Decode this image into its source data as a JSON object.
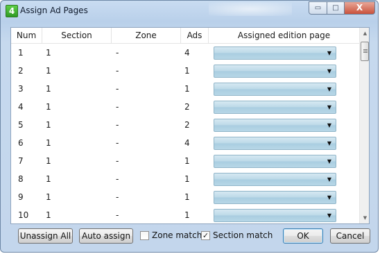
{
  "window": {
    "title": "Assign Ad Pages",
    "icon_glyph": "4"
  },
  "titlebar_buttons": {
    "minimize": "▭",
    "maximize": "□",
    "close": "X"
  },
  "columns": [
    "Num",
    "Section",
    "Zone",
    "Ads",
    "Assigned edition page"
  ],
  "rows": [
    {
      "num": "1",
      "section": "1",
      "zone": "-",
      "ads": "4"
    },
    {
      "num": "2",
      "section": "1",
      "zone": "-",
      "ads": "1"
    },
    {
      "num": "3",
      "section": "1",
      "zone": "-",
      "ads": "1"
    },
    {
      "num": "4",
      "section": "1",
      "zone": "-",
      "ads": "2"
    },
    {
      "num": "5",
      "section": "1",
      "zone": "-",
      "ads": "2"
    },
    {
      "num": "6",
      "section": "1",
      "zone": "-",
      "ads": "4"
    },
    {
      "num": "7",
      "section": "1",
      "zone": "-",
      "ads": "1"
    },
    {
      "num": "8",
      "section": "1",
      "zone": "-",
      "ads": "1"
    },
    {
      "num": "9",
      "section": "1",
      "zone": "-",
      "ads": "1"
    },
    {
      "num": "10",
      "section": "1",
      "zone": "-",
      "ads": "1"
    }
  ],
  "dropdown_arrow": "▼",
  "scrollbar": {
    "up": "▲",
    "down": "▼"
  },
  "footer": {
    "unassign_all": "Unassign All",
    "auto_assign": "Auto assign",
    "zone_match": {
      "label": "Zone match",
      "checked": false
    },
    "section_match": {
      "label": "Section match",
      "checked": true
    },
    "ok": "OK",
    "cancel": "Cancel"
  }
}
